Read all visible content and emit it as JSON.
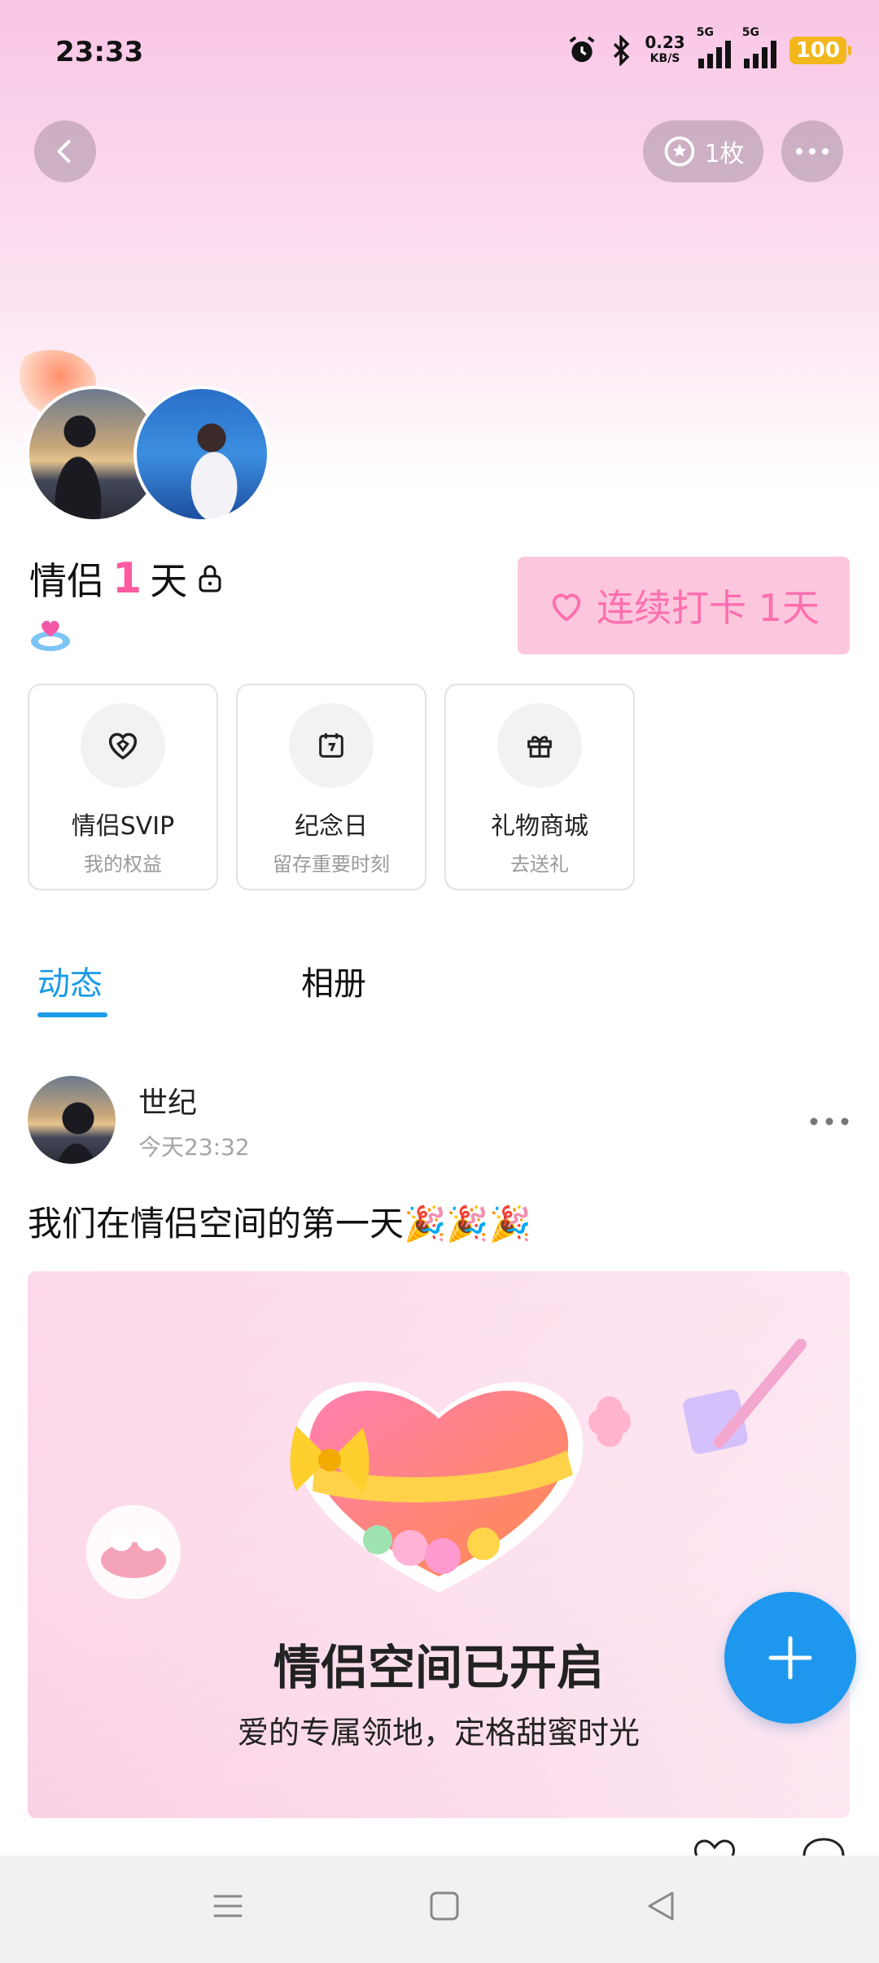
{
  "status_bar": {
    "time": "23:33",
    "net_speed_value": "0.23",
    "net_speed_unit": "KB/S",
    "signal_1_label": "5G",
    "signal_2_label": "5G",
    "battery": "100"
  },
  "header": {
    "badge_count_label": "1枚"
  },
  "profile": {
    "title_prefix": "情侣",
    "days_number": "1",
    "days_suffix": "天",
    "checkin_label": "连续打卡 1天"
  },
  "feature_cards": [
    {
      "title": "情侣SVIP",
      "subtitle": "我的权益",
      "icon": "heart-diamond-icon"
    },
    {
      "title": "纪念日",
      "subtitle": "留存重要时刻",
      "icon": "calendar-icon"
    },
    {
      "title": "礼物商城",
      "subtitle": "去送礼",
      "icon": "gift-icon"
    }
  ],
  "tabs": [
    {
      "label": "动态",
      "active": true
    },
    {
      "label": "相册",
      "active": false
    }
  ],
  "post": {
    "author": "世纪",
    "time": "今天23:32",
    "text": "我们在情侣空间的第一天🎉🎉🎉",
    "banner_title": "情侣空间已开启",
    "banner_subtitle": "爱的专属领地，定格甜蜜时光"
  },
  "colors": {
    "accent_blue": "#1e98ee",
    "pink_accent": "#ff5aa0",
    "checkin_bg": "#fcc6dd"
  }
}
